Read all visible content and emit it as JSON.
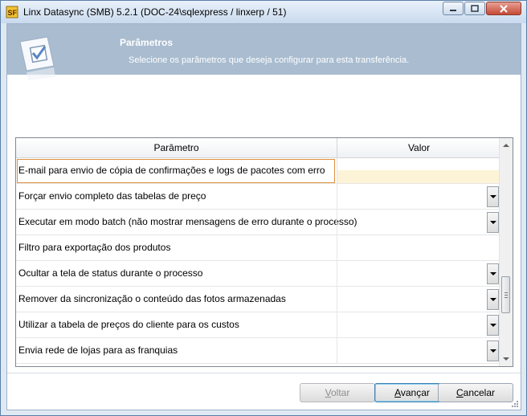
{
  "window": {
    "title": "Linx Datasync (SMB) 5.2.1 (DOC-24\\sqlexpress / linxerp / 51)"
  },
  "header": {
    "title": "Parâmetros",
    "subtitle": "Selecione os parâmetros que deseja configurar para esta transferência."
  },
  "grid": {
    "col_param": "Parâmetro",
    "col_value": "Valor",
    "rows": [
      {
        "label": "E-mail para envio de cópia de confirmações e logs de pacotes com erro",
        "value": ""
      },
      {
        "label": "Forçar envio completo das tabelas de preço",
        "value": ""
      },
      {
        "label": "Executar em modo batch (não mostrar mensagens de erro durante o processo)",
        "value": ""
      },
      {
        "label": "Filtro para exportação dos produtos",
        "value": ""
      },
      {
        "label": "Ocultar a tela de status durante o processo",
        "value": ""
      },
      {
        "label": "Remover da sincronização o conteúdo das fotos armazenadas",
        "value": ""
      },
      {
        "label": "Utilizar a tabela de preços do cliente para os custos",
        "value": ""
      },
      {
        "label": "Envia rede de lojas para as franquias",
        "value": ""
      }
    ]
  },
  "buttons": {
    "back": {
      "first": "V",
      "rest": "oltar"
    },
    "next": {
      "first": "A",
      "rest": "vançar"
    },
    "cancel": {
      "first": "C",
      "rest": "ancelar"
    }
  },
  "colors": {
    "header_bg": "#a9bcd0",
    "selection_border": "#e0913e",
    "selection_fill": "#fdf3d6",
    "close_button": "#c54a36"
  }
}
